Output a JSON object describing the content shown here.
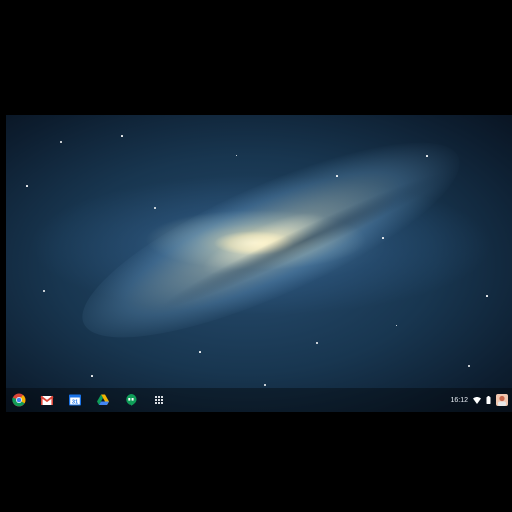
{
  "shelf": {
    "apps": [
      {
        "name": "chrome-icon"
      },
      {
        "name": "gmail-icon"
      },
      {
        "name": "calendar-icon",
        "label": "31"
      },
      {
        "name": "drive-icon"
      },
      {
        "name": "hangouts-icon"
      },
      {
        "name": "app-launcher-icon"
      }
    ]
  },
  "tray": {
    "time": "16:12",
    "icons": [
      "wifi-icon",
      "battery-icon",
      "user-avatar"
    ]
  },
  "colors": {
    "sky_dark": "#060d18",
    "sky_blue": "#274c6e",
    "galaxy_core": "#fff5cd"
  }
}
